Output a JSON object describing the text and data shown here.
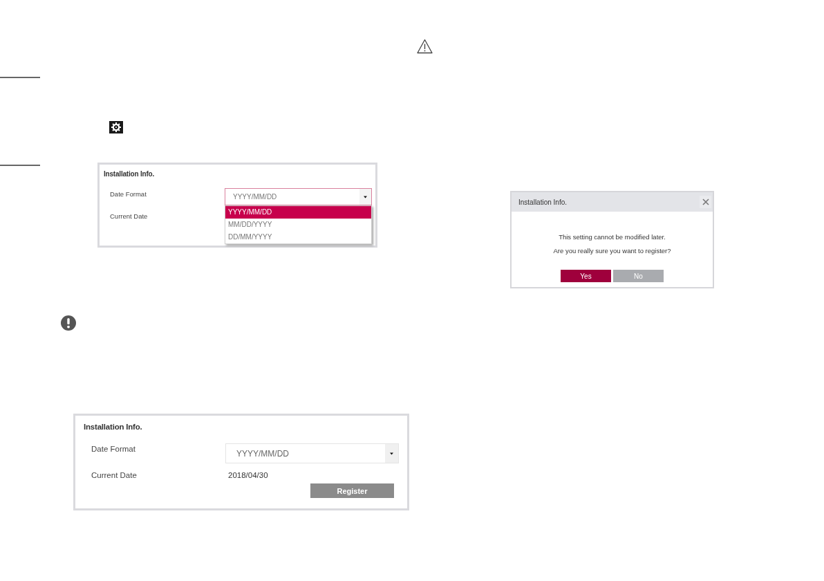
{
  "panels": [
    {
      "title": "Installation Info.",
      "date_format": {
        "label": "Date Format",
        "value": "YYYY/MM/DD",
        "expanded": true,
        "options": [
          {
            "label": "YYYY/MM/DD",
            "selected": true
          },
          {
            "label": "MM/DD/YYYY",
            "selected": false
          },
          {
            "label": "DD/MM/YYYY",
            "selected": false
          }
        ]
      },
      "current_date": {
        "label": "Current Date"
      }
    },
    {
      "title": "Installation Info.",
      "date_format": {
        "label": "Date Format",
        "value": "YYYY/MM/DD",
        "expanded": false
      },
      "current_date": {
        "label": "Current Date",
        "value": "2018/04/30"
      },
      "register_button": "Register"
    }
  ],
  "dialog": {
    "title": "Installation Info.",
    "message": [
      "This setting cannot be modified later.",
      "Are you really sure you want to register?"
    ],
    "buttons": [
      {
        "label": "Yes",
        "kind": "primary"
      },
      {
        "label": "No",
        "kind": "secondary"
      }
    ]
  }
}
